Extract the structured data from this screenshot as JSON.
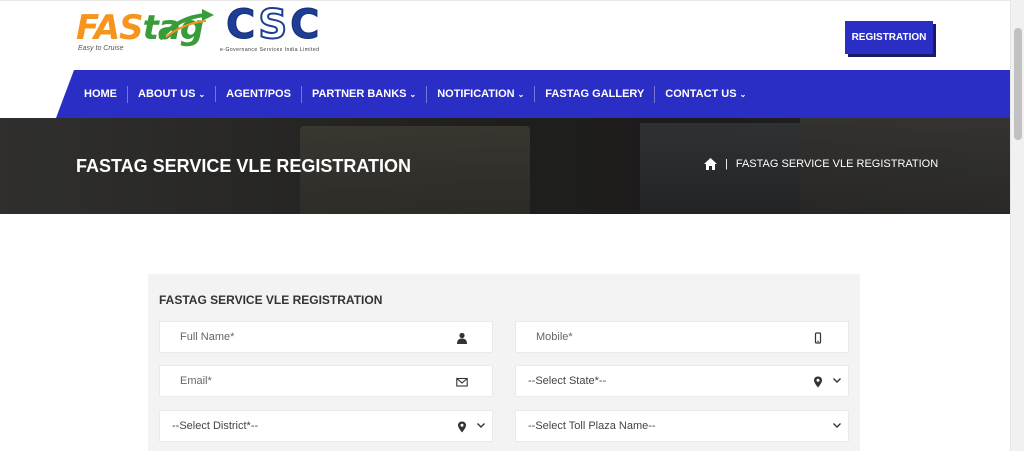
{
  "header": {
    "fastag_logo": {
      "part1": "FAS",
      "part2": "tag",
      "tagline": "Easy to Cruise"
    },
    "csc_logo": {
      "letters": [
        "C",
        "S",
        "C"
      ],
      "subtitle": "e-Governance Services India Limited"
    },
    "registration_button": "REGISTRATION"
  },
  "nav": {
    "items": [
      {
        "label": "HOME",
        "dropdown": false
      },
      {
        "label": "ABOUT US",
        "dropdown": true
      },
      {
        "label": "AGENT/POS",
        "dropdown": false
      },
      {
        "label": "PARTNER BANKS",
        "dropdown": true
      },
      {
        "label": "NOTIFICATION",
        "dropdown": true
      },
      {
        "label": "FASTAG GALLERY",
        "dropdown": false
      },
      {
        "label": "CONTACT US",
        "dropdown": true
      }
    ],
    "chevron": "⌄"
  },
  "banner": {
    "title": "FASTAG SERVICE VLE REGISTRATION",
    "breadcrumb_separator": "|",
    "breadcrumb_current": "FASTAG SERVICE VLE REGISTRATION"
  },
  "form": {
    "title": "FASTAG SERVICE VLE REGISTRATION",
    "full_name": "Full Name*",
    "mobile": "Mobile*",
    "email": "Email*",
    "state": "--Select State*--",
    "district": "--Select District*--",
    "toll_plaza": "--Select Toll Plaza Name--"
  },
  "colors": {
    "nav_bg": "#2b2ec5",
    "button_bg": "#2b2ec5",
    "fastag_orange": "#f7941d",
    "fastag_green": "#3a9b3a",
    "csc_blue": "#1e3e96"
  },
  "icons": [
    "user-icon",
    "mobile-icon",
    "envelope-icon",
    "map-marker-icon",
    "chevron-down-icon",
    "home-icon"
  ]
}
